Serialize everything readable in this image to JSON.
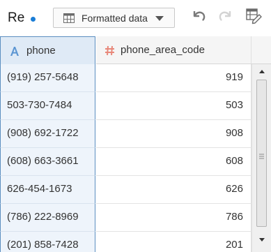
{
  "toolbar": {
    "tab_title": "Re",
    "format_select": {
      "selected": "Formatted data"
    }
  },
  "icons": {
    "grid": "grid-icon",
    "undo": "undo-icon",
    "redo": "redo-icon",
    "edit_table": "edit-table-icon",
    "text_type": "text-type-icon",
    "number_type": "hash-icon"
  },
  "colors": {
    "accent": "#1a7dd6",
    "selected_column_bg": "#eef4fb",
    "selected_column_border": "#5b8ec0",
    "number_type_icon": "#e8887a"
  },
  "table": {
    "columns": [
      {
        "label": "phone",
        "type": "text",
        "selected": true
      },
      {
        "label": "phone_area_code",
        "type": "number",
        "selected": false
      }
    ],
    "rows": [
      {
        "phone": "(919) 257-5648",
        "phone_area_code": "919"
      },
      {
        "phone": "503-730-7484",
        "phone_area_code": "503"
      },
      {
        "phone": "(908) 692-1722",
        "phone_area_code": "908"
      },
      {
        "phone": "(608) 663-3661",
        "phone_area_code": "608"
      },
      {
        "phone": "626-454-1673",
        "phone_area_code": "626"
      },
      {
        "phone": "(786) 222-8969",
        "phone_area_code": "786"
      },
      {
        "phone": "(201) 858-7428",
        "phone_area_code": "201"
      }
    ]
  }
}
